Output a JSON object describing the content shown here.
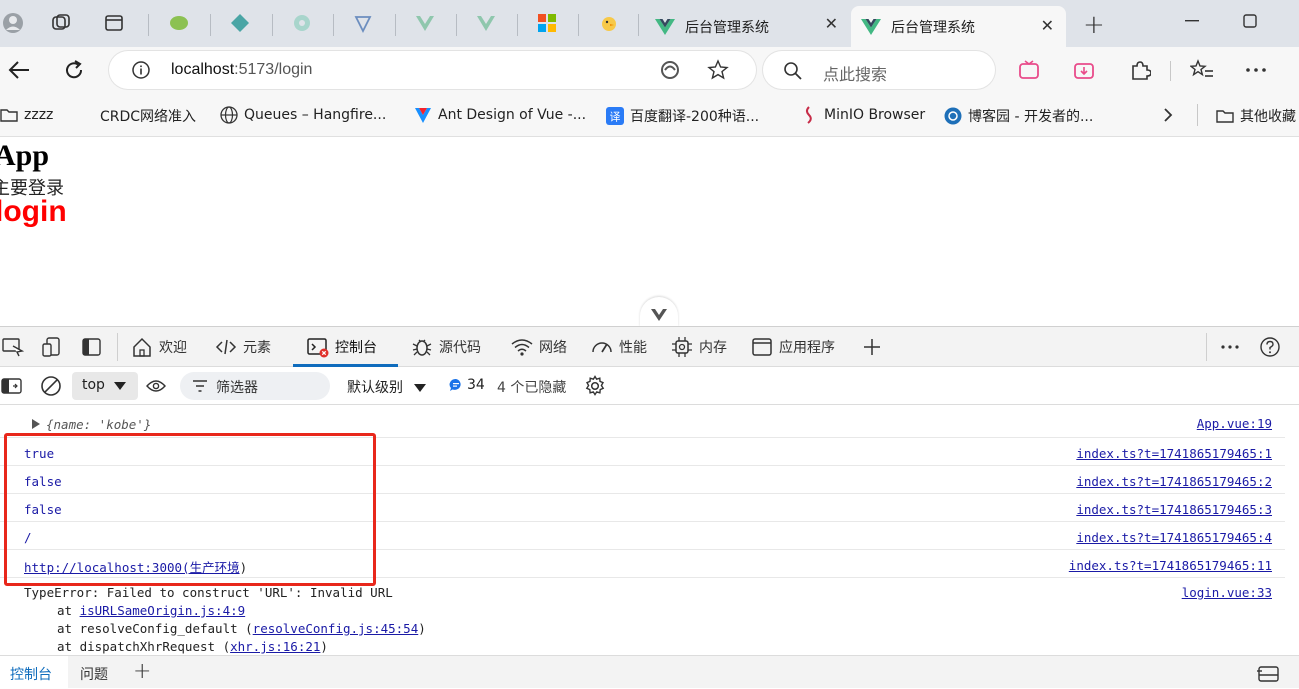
{
  "browser": {
    "tabs": [
      {
        "title": "后台管理系统",
        "active": false
      },
      {
        "title": "后台管理系统",
        "active": true
      }
    ],
    "new_tab_glyph": "+",
    "close_glyph": "✕",
    "address": {
      "host": "localhost",
      "port_path": ":5173/login"
    },
    "search": {
      "placeholder": "点此搜索"
    },
    "bookmarks": [
      {
        "label": "zzzz",
        "icon": "folder-icon"
      },
      {
        "label": "CRDC网络准入",
        "icon": "page-icon"
      },
      {
        "label": "Queues – Hangfire...",
        "icon": "globe-icon"
      },
      {
        "label": "Ant Design of Vue -...",
        "icon": "antd-icon"
      },
      {
        "label": "百度翻译-200种语...",
        "icon": "translate-icon"
      },
      {
        "label": "MinIO Browser",
        "icon": "minio-icon"
      },
      {
        "label": "博客园 - 开发者的...",
        "icon": "cnblogs-icon"
      },
      {
        "label": "其他收藏",
        "icon": "folder-icon"
      }
    ]
  },
  "page": {
    "app_title": "App",
    "message": "主要登录",
    "login_title": "login"
  },
  "devtools": {
    "tabs": [
      {
        "label": "欢迎",
        "icon": "home-icon"
      },
      {
        "label": "元素",
        "icon": "code-icon"
      },
      {
        "label": "控制台",
        "icon": "console-icon",
        "active": true
      },
      {
        "label": "源代码",
        "icon": "bug-icon"
      },
      {
        "label": "网络",
        "icon": "wifi-icon"
      },
      {
        "label": "性能",
        "icon": "performance-icon"
      },
      {
        "label": "内存",
        "icon": "chip-icon"
      },
      {
        "label": "应用程序",
        "icon": "app-icon"
      }
    ],
    "toolbar": {
      "context": "top",
      "filter_label": "筛选器",
      "level_label": "默认级别",
      "message_count": "34",
      "hidden_count": "4 个已隐藏"
    },
    "console": {
      "object_log": {
        "text": "{name: 'kobe'}",
        "source": "App.vue:19"
      },
      "logs": [
        {
          "text": "true",
          "source": "index.ts?t=1741865179465:1"
        },
        {
          "text": "false",
          "source": "index.ts?t=1741865179465:2"
        },
        {
          "text": "false",
          "source": "index.ts?t=1741865179465:3"
        },
        {
          "text": "/",
          "source": "index.ts?t=1741865179465:4"
        },
        {
          "text_link": "http://localhost:3000(生产环境",
          "text_tail": ")",
          "source": "index.ts?t=1741865179465:11"
        }
      ],
      "error": {
        "message": "TypeError: Failed to construct 'URL': Invalid URL",
        "source": "login.vue:33",
        "stack": [
          {
            "prefix": "at ",
            "fn": "",
            "link": "isURLSameOrigin.js:4:9",
            "suffix": ""
          },
          {
            "prefix": "at resolveConfig_default (",
            "fn": "",
            "link": "resolveConfig.js:45:54",
            "suffix": ")"
          },
          {
            "prefix": "at dispatchXhrRequest (",
            "fn": "",
            "link": "xhr.js:16:21",
            "suffix": ")"
          }
        ]
      }
    },
    "drawer": {
      "tabs": [
        "控制台",
        "问题"
      ],
      "add_glyph": "+"
    },
    "colors": {
      "accent": "#0f6cbd",
      "highlight_box": "#e8271b",
      "login_text": "#ff0000",
      "console_blue": "#1a1aa6"
    }
  }
}
